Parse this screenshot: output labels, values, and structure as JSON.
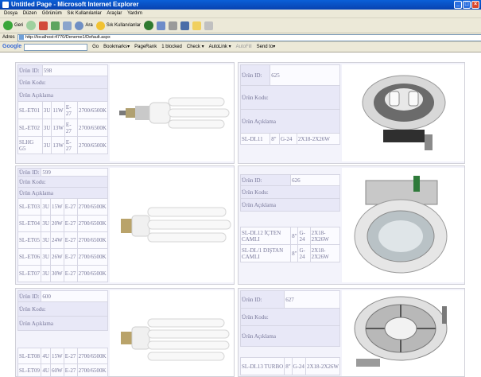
{
  "window": {
    "title": "Untitled Page - Microsoft Internet Explorer"
  },
  "menu": [
    "Dosya",
    "Düzen",
    "Görünüm",
    "Sık Kullanılanlar",
    "Araçlar",
    "Yardım"
  ],
  "toolbar": {
    "back": "Geri",
    "search": "Ara",
    "favorites": "Sık Kullanılanlar"
  },
  "address": {
    "label": "Adres",
    "url": "http://localhost:4770/Deneme1/Default.aspx"
  },
  "google_bar": {
    "logo": "Google",
    "go": "Go",
    "bookmarks": "Bookmarks▾",
    "pagerank": "PageRank",
    "blocked": "1 blocked",
    "check": "Check ▾",
    "autolink": "AutoLink ▾",
    "autofill": "AutoFill",
    "send_to": "Send to▾"
  },
  "labels": {
    "id": "Ürün ID:",
    "code": "Ürün Kodu:",
    "desc": "Ürün Açıklama"
  },
  "products": [
    {
      "id": "598",
      "rows": [
        [
          "SL-ET01",
          "3U",
          "11W",
          "E-27",
          "2700/6500K"
        ],
        [
          "SL-ET02",
          "3U",
          "13W",
          "E-27",
          "2700/6500K"
        ],
        [
          "SLHG G5",
          "3U",
          "13W",
          "E-27",
          "2700/6500K"
        ]
      ]
    },
    {
      "id": "625",
      "rows": [
        [
          "SL-DL11",
          "8\"",
          "G-24",
          "2X18-2X26W"
        ]
      ]
    },
    {
      "id": "599",
      "rows": [
        [
          "SL-ET03",
          "3U",
          "15W",
          "E-27",
          "2700/6500K"
        ],
        [
          "SL-ET04",
          "3U",
          "20W",
          "E-27",
          "2700/6500K"
        ],
        [
          "SL-ET05",
          "3U",
          "24W",
          "E-27",
          "2700/6500K"
        ],
        [
          "SL-ET06",
          "3U",
          "26W",
          "E-27",
          "2700/6500K"
        ],
        [
          "SL-ET07",
          "3U",
          "30W",
          "E-27",
          "2700/6500K"
        ]
      ]
    },
    {
      "id": "626",
      "rows": [
        [
          "SL-DL12 İÇTEN CAMLI",
          "8\"",
          "G-24",
          "2X18-2X26W"
        ],
        [
          "SL-DL/1 DIŞTAN CAMLI",
          "8\"",
          "G-24",
          "2X18-2X26W"
        ]
      ]
    },
    {
      "id": "600",
      "rows": [
        [
          "SL-ET08",
          "4U",
          "15W",
          "E-27",
          "2700/6500K"
        ],
        [
          "SL-ET09",
          "4U",
          "60W",
          "E-27",
          "2700/6500K"
        ]
      ]
    },
    {
      "id": "627",
      "rows": [
        [
          "SL-DL13 TURBO",
          "8\"",
          "G-24",
          "2X18-2X26W"
        ]
      ]
    }
  ]
}
